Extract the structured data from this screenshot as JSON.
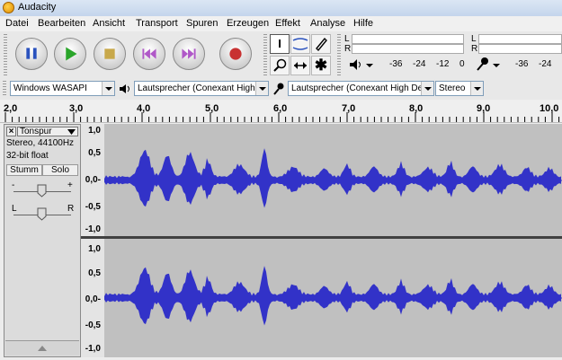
{
  "window": {
    "title": "Audacity"
  },
  "menu": [
    "Datei",
    "Bearbeiten",
    "Ansicht",
    "Transport",
    "Spuren",
    "Erzeugen",
    "Effekt",
    "Analyse",
    "Hilfe"
  ],
  "meters": {
    "channels": [
      "L",
      "R"
    ],
    "ticks_play": [
      "-36",
      "-24",
      "-12",
      "0"
    ],
    "ticks_rec": [
      "-36",
      "-24"
    ]
  },
  "device": {
    "host": "Windows WASAPI",
    "output": "Lautsprecher (Conexant High I",
    "input": "Lautsprecher (Conexant High Defi",
    "channels": "Stereo"
  },
  "ruler": {
    "ticks": [
      "2,0",
      "3,0",
      "4,0",
      "5,0",
      "6,0",
      "7,0",
      "8,0",
      "9,0",
      "10,0"
    ]
  },
  "track": {
    "name": "Tonspur",
    "info_line1": "Stereo, 44100Hz",
    "info_line2": "32-bit float",
    "mute_label": "Stumm",
    "solo_label": "Solo",
    "gain_minus": "-",
    "gain_plus": "+",
    "pan_left": "L",
    "pan_right": "R"
  },
  "scale": {
    "labels": [
      "1,0",
      "0,5",
      "0,0-",
      "-0,5",
      "-1,0"
    ]
  },
  "colors": {
    "waveform": "#3232c8",
    "background": "#c0c0c0"
  }
}
